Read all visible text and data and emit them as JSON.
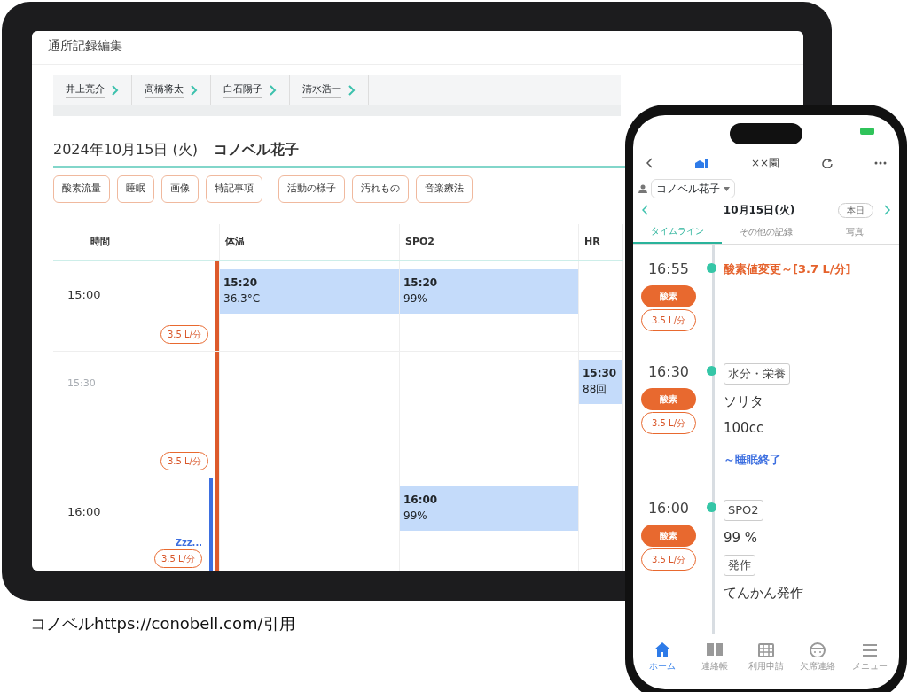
{
  "tablet": {
    "title": "通所記録編集",
    "staff_tabs": [
      {
        "name": "井上亮介"
      },
      {
        "name": "高橋将太"
      },
      {
        "name": "白石陽子"
      },
      {
        "name": "清水浩一"
      }
    ],
    "date_heading": "2024年10月15日 (火)",
    "patient_name": "コノベル花子",
    "category_buttons": [
      "酸素流量",
      "睡眠",
      "画像",
      "特記事項",
      "活動の様子",
      "汚れもの",
      "音楽療法"
    ],
    "table": {
      "time_header": "時間",
      "columns": [
        "体温",
        "SPO2",
        "HR"
      ],
      "rows": [
        {
          "time": "15:00",
          "kind": "hour",
          "oxygen": "3.5 L/分",
          "cells": [
            {
              "time": "15:20",
              "value": "36.3°C"
            },
            {
              "time": "15:20",
              "value": "99%"
            },
            null
          ]
        },
        {
          "time": "15:30",
          "kind": "half_hour",
          "oxygen": "3.5 L/分",
          "cells": [
            null,
            null,
            {
              "time": "15:30",
              "value": "88回"
            }
          ]
        },
        {
          "time": "16:00",
          "kind": "hour",
          "oxygen": "3.5 L/分",
          "sleep": "Zzz...",
          "cells": [
            null,
            {
              "time": "16:00",
              "value": "99%"
            },
            null
          ]
        }
      ]
    }
  },
  "phone": {
    "title": "××園",
    "person": "コノベル花子",
    "date": "10月15日(火)",
    "today_button": "本日",
    "tabs": [
      {
        "label": "タイムライン",
        "selected": true
      },
      {
        "label": "その他の記録",
        "selected": false
      },
      {
        "label": "写真",
        "selected": false
      }
    ],
    "timeline": [
      {
        "time": "16:55",
        "badge": "酸素",
        "oxygen": "3.5 L/分",
        "items": [
          {
            "kind": "alert",
            "text": "酸素値変更～[3.7 L/分]"
          }
        ]
      },
      {
        "time": "16:30",
        "badge": "酸素",
        "oxygen": "3.5 L/分",
        "items": [
          {
            "kind": "tag",
            "text": "水分・栄養"
          },
          {
            "kind": "text",
            "text": "ソリタ"
          },
          {
            "kind": "text",
            "text": "100cc"
          },
          {
            "kind": "note",
            "text": "～睡眠終了"
          }
        ]
      },
      {
        "time": "16:00",
        "badge": "酸素",
        "oxygen": "3.5 L/分",
        "items": [
          {
            "kind": "tag",
            "text": "SPO2"
          },
          {
            "kind": "text",
            "text": "99 %"
          },
          {
            "kind": "tag",
            "text": "発作"
          },
          {
            "kind": "text",
            "text": "てんかん発作"
          }
        ]
      }
    ],
    "nav": [
      {
        "label": "ホーム",
        "selected": true
      },
      {
        "label": "連絡帳",
        "selected": false
      },
      {
        "label": "利用申請",
        "selected": false
      },
      {
        "label": "欠席連絡",
        "selected": false
      },
      {
        "label": "メニュー",
        "selected": false
      }
    ]
  },
  "caption": "コノベルhttps://conobell.com/引用"
}
